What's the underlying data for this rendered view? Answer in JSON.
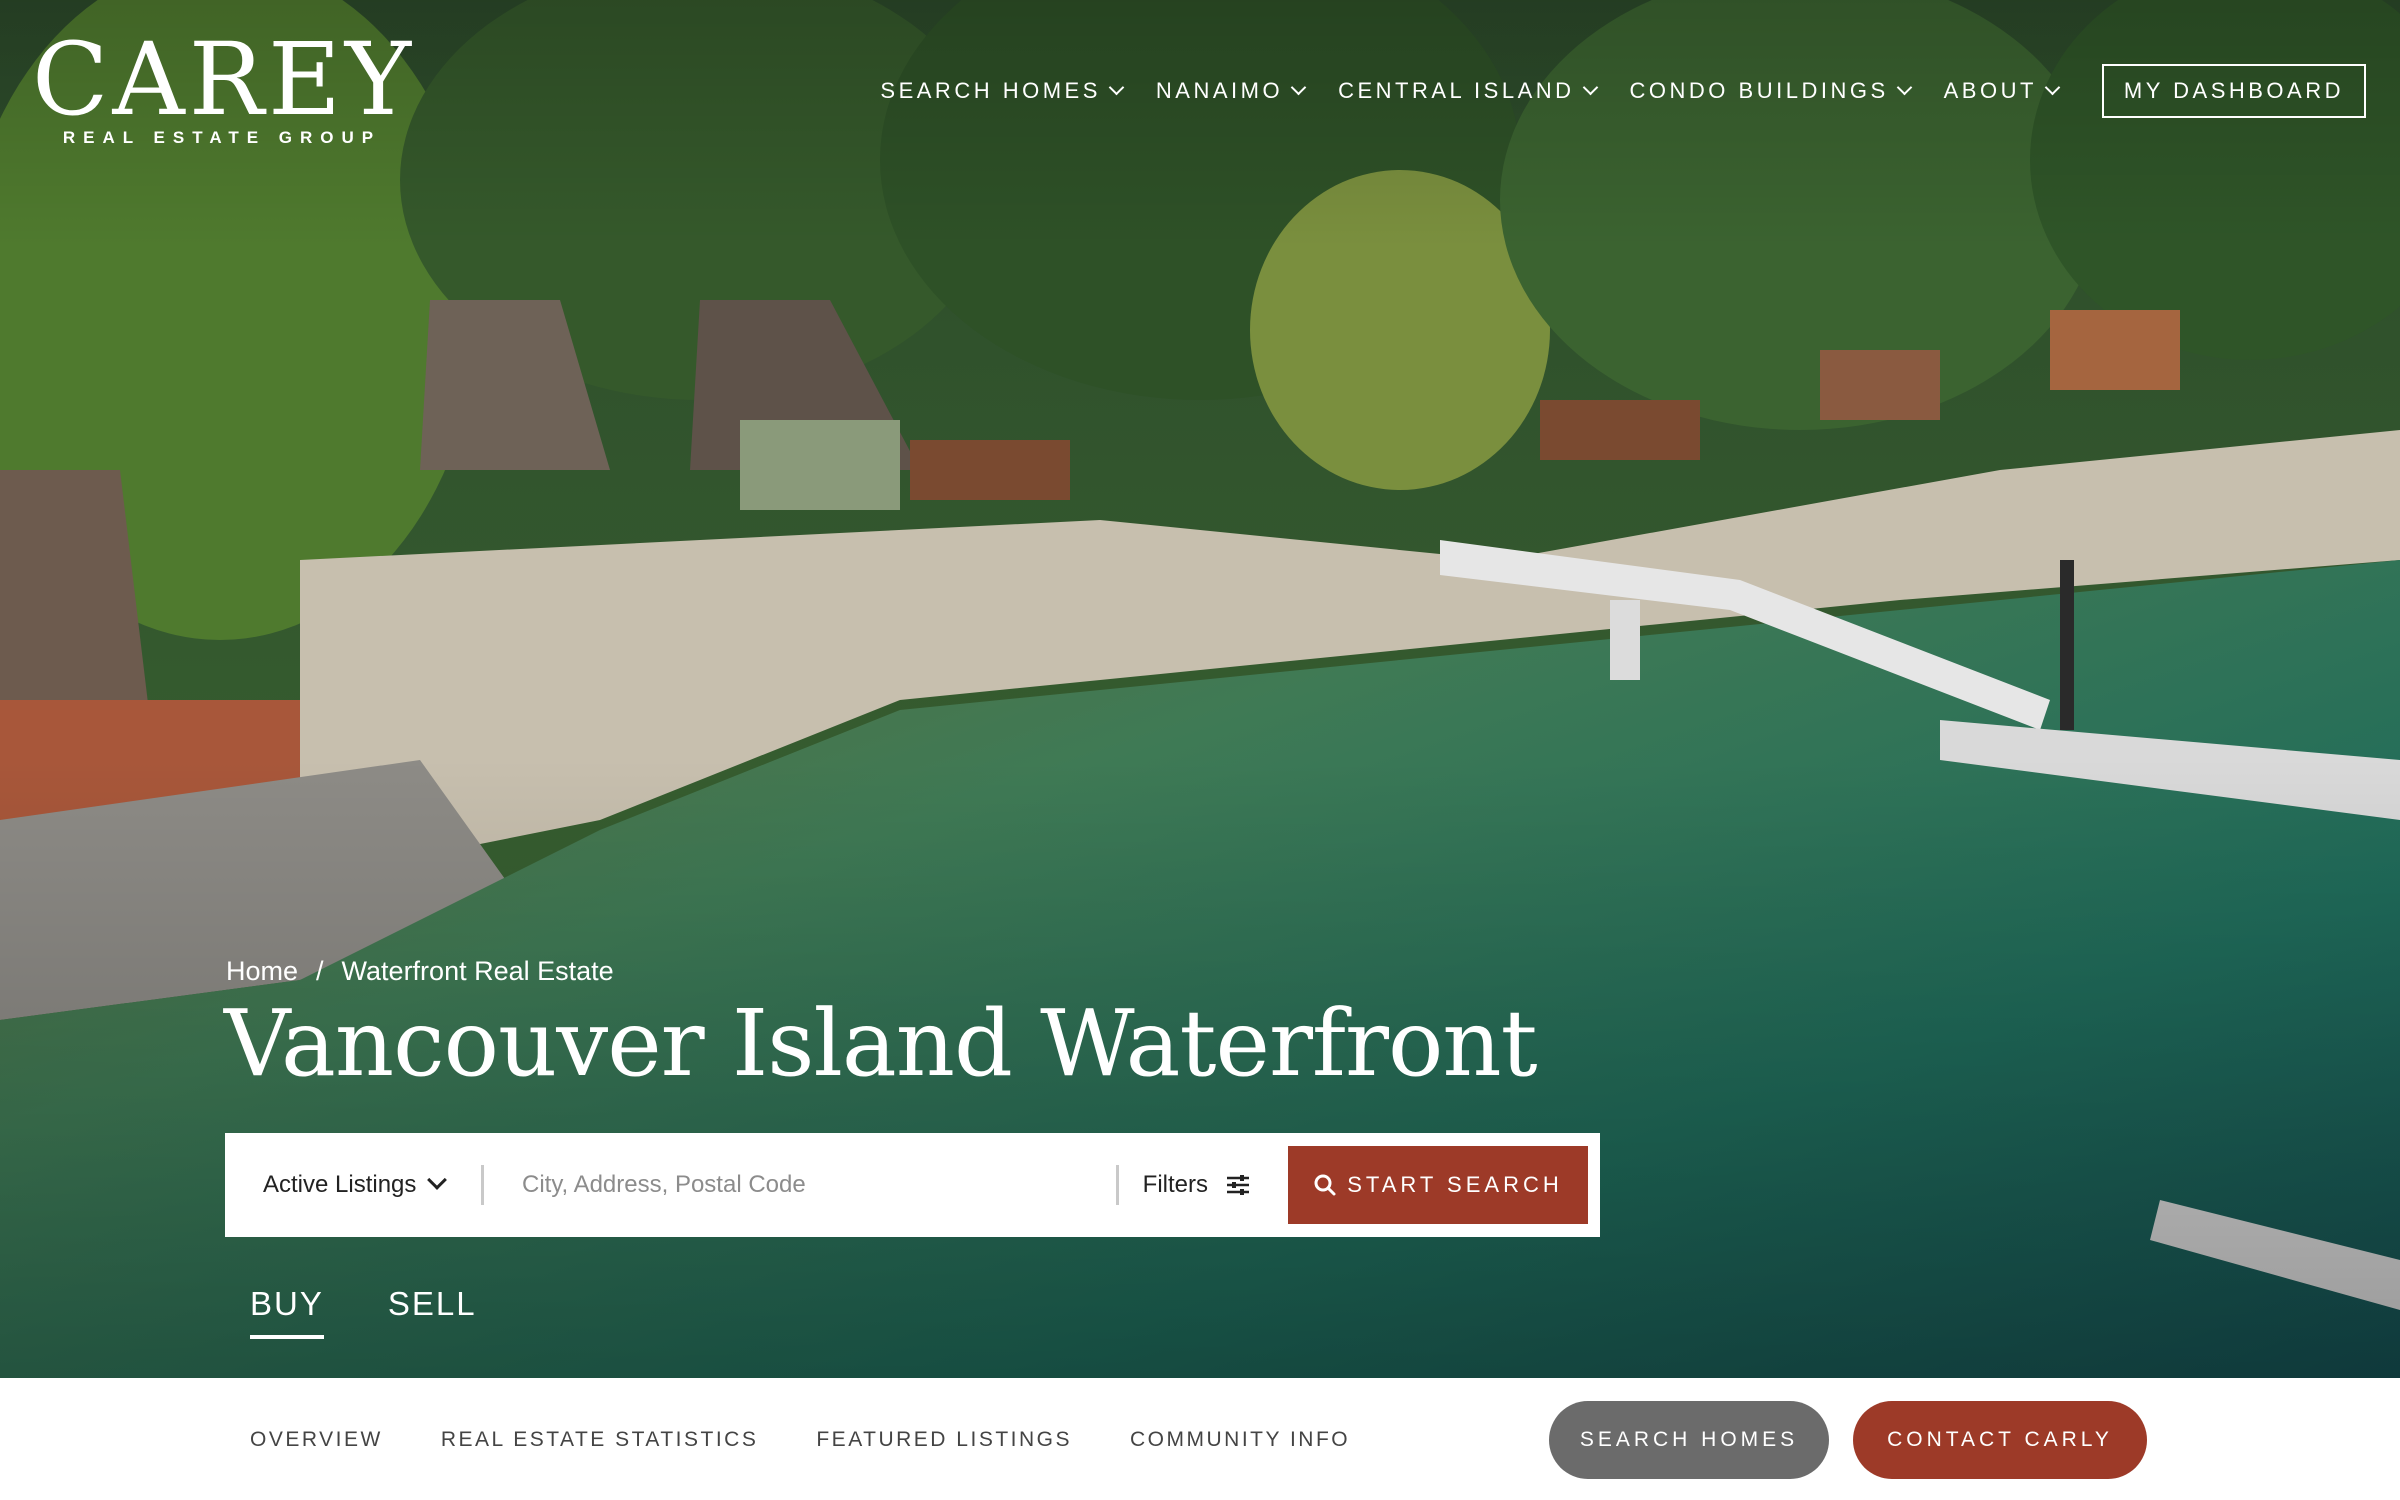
{
  "logo": {
    "word": "CAREY",
    "sub": "REAL ESTATE GROUP"
  },
  "nav": {
    "items": [
      {
        "label": "SEARCH HOMES",
        "icon": "chevron-down-icon"
      },
      {
        "label": "NANAIMO",
        "icon": "chevron-down-icon"
      },
      {
        "label": "CENTRAL ISLAND",
        "icon": "chevron-down-icon"
      },
      {
        "label": "CONDO BUILDINGS",
        "icon": "chevron-down-icon"
      },
      {
        "label": "ABOUT",
        "icon": "chevron-down-icon"
      }
    ],
    "dashboard": "MY DASHBOARD"
  },
  "breadcrumb": {
    "home": "Home",
    "separator": "/",
    "current": "Waterfront Real Estate"
  },
  "page_title": "Vancouver Island Waterfront",
  "search": {
    "status": "Active Listings",
    "placeholder": "City, Address, Postal Code",
    "filters": "Filters",
    "start": "START SEARCH"
  },
  "tabs": {
    "buy": "BUY",
    "sell": "SELL",
    "active": "BUY"
  },
  "subnav": {
    "items": [
      "OVERVIEW",
      "REAL ESTATE STATISTICS",
      "FEATURED LISTINGS",
      "COMMUNITY INFO"
    ]
  },
  "cta": {
    "search_homes": "SEARCH HOMES",
    "contact": "CONTACT CARLY"
  },
  "colors": {
    "accent": "#9d3a28",
    "gray_button": "#6b6b6b",
    "water": "#1f6b5a",
    "forest": "#2f5a3a"
  }
}
